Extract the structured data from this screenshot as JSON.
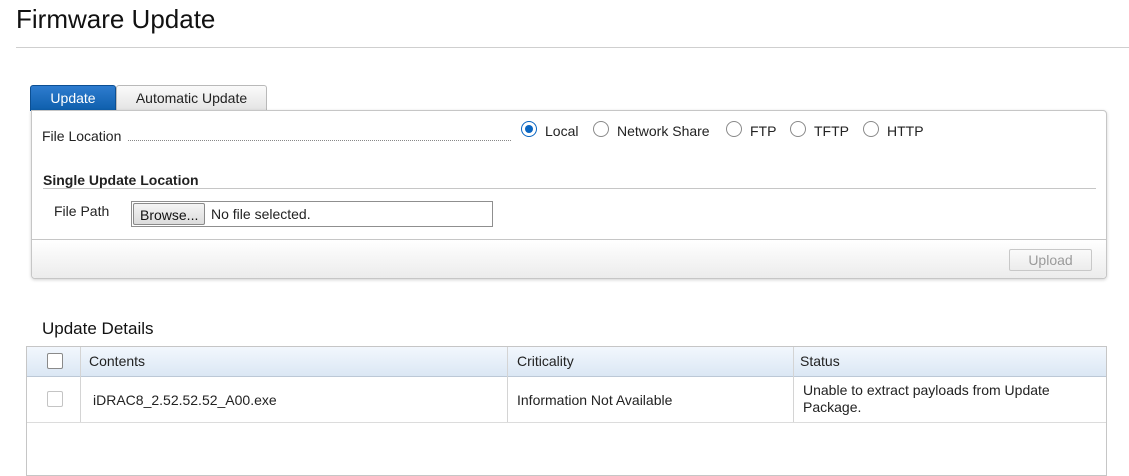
{
  "page": {
    "title": "Firmware Update"
  },
  "tabs": [
    {
      "label": "Update",
      "active": true
    },
    {
      "label": "Automatic Update",
      "active": false
    }
  ],
  "form": {
    "file_location_label": "File Location",
    "location_options": [
      {
        "label": "Local",
        "selected": true
      },
      {
        "label": "Network Share",
        "selected": false
      },
      {
        "label": "FTP",
        "selected": false
      },
      {
        "label": "TFTP",
        "selected": false
      },
      {
        "label": "HTTP",
        "selected": false
      }
    ],
    "section_title": "Single Update Location",
    "file_path_label": "File Path",
    "browse_label": "Browse...",
    "file_status": "No file selected.",
    "upload_label": "Upload"
  },
  "details": {
    "title": "Update Details",
    "columns": [
      "Contents",
      "Criticality",
      "Status"
    ],
    "rows": [
      {
        "contents": "iDRAC8_2.52.52.52_A00.exe",
        "criticality": "Information Not Available",
        "status": "Unable to extract payloads from Update Package."
      }
    ]
  },
  "colors": {
    "accent": "#0d5eab",
    "header_bg": "#dbe7f4"
  }
}
